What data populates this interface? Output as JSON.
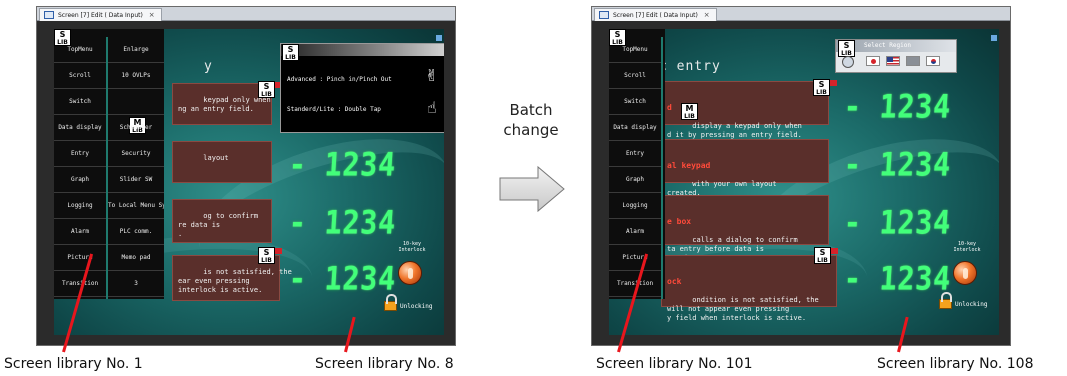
{
  "left_panel": {
    "tab_title": "Screen [7] Edit (",
    "tab_subtitle": "Data Input)",
    "tab_close": "×",
    "screen_title_fragment": "y",
    "menu_items_col1": [
      "TopMenu",
      "Scroll",
      "Switch",
      "Data display",
      "Entry",
      "Graph",
      "Logging",
      "Alarm",
      "Picture",
      "Transition"
    ],
    "menu_items_col2": [
      "Enlarge",
      "10 OVLPs",
      "",
      "Scheduler",
      "Security",
      "Slider SW",
      "To Local Menu System",
      "PLC comm.",
      "Memo pad",
      "3"
    ],
    "panels": [
      {
        "title": "",
        "text": "keypad only when\nng an entry field."
      },
      {
        "title": "",
        "text": "layout"
      },
      {
        "title": "",
        "text": "og to confirm\nre data is\n."
      },
      {
        "title": "",
        "text": "is not satisfied, the\near even pressing\ninterlock is active."
      }
    ],
    "popup": {
      "advanced": "Advanced : Pinch in/Pinch Out",
      "standard": "Standerd/Lite : Double Tap"
    },
    "numbers": [
      "- 1234",
      "- 1234",
      "- 1234"
    ],
    "interlock_label": "10-key Interlock",
    "unlocking": "Unlocking",
    "lib_badge": "LIB",
    "lib_s": "S",
    "lib_m": "M"
  },
  "right_panel": {
    "tab_title": "Screen [7] Edit (",
    "tab_subtitle": "Data Input)",
    "tab_close": "×",
    "screen_title_fragment": "c entry",
    "menu_items": [
      "TopMenu",
      "Scroll",
      "Switch",
      "Data display",
      "Entry",
      "Graph",
      "Logging",
      "Alarm",
      "Picture",
      "Transition"
    ],
    "region_title": "Select Region",
    "panels": [
      {
        "title": "d",
        "text": "display a keypad only when\nd it by pressing an entry field."
      },
      {
        "title": "al keypad",
        "text": "with your own layout\ncreated."
      },
      {
        "title": "e box",
        "text": "calls a dialog to confirm\nta entry before data is\ny written."
      },
      {
        "title": "ock",
        "text": "ondition is not satisfied, the\nwill not appear even pressing\ny field when interlock is active."
      }
    ],
    "numbers": [
      "- 1234",
      "- 1234",
      "- 1234",
      "- 1234"
    ],
    "interlock_label": "10-key Interlock",
    "unlocking": "Unlocking",
    "lib_badge": "LIB",
    "lib_s": "S",
    "lib_m": "M"
  },
  "transition": {
    "label_line1": "Batch",
    "label_line2": "change"
  },
  "captions": {
    "left_1": "Screen library No. 1",
    "left_8": "Screen library No. 8",
    "right_101": "Screen library No. 101",
    "right_108": "Screen library No. 108"
  },
  "colors": {
    "accent_red": "#e8161d",
    "digit_green": "#42ff7a",
    "panel_red_title": "#ff4a3a",
    "screen_teal": "#1b6a68"
  },
  "icons": {
    "tab_icon": "screen-edit-icon",
    "hand_pinch": "pinch-gesture-icon",
    "hand_tap": "double-tap-icon",
    "lock": "padlock-open-icon",
    "interlock_button": "interlock-button-icon",
    "globe": "globe-icon"
  }
}
